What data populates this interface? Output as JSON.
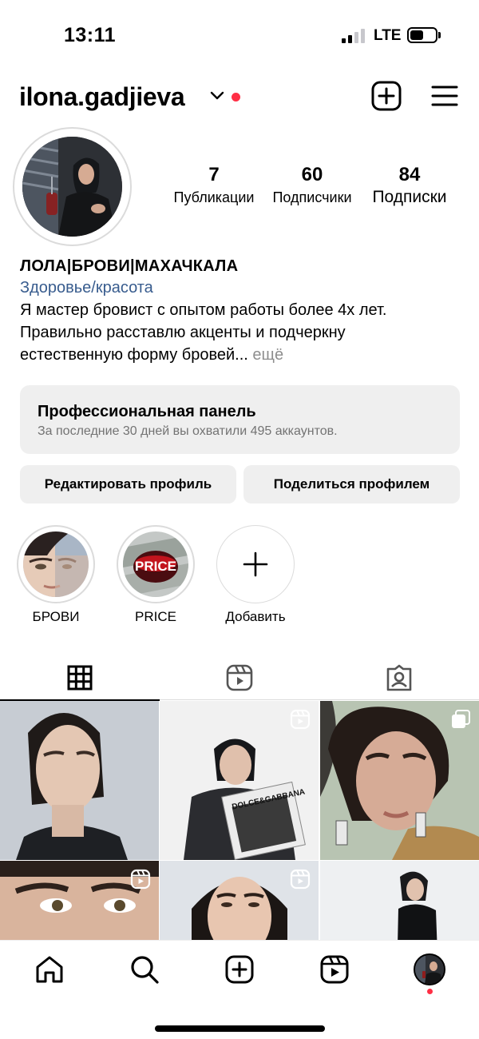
{
  "status_bar": {
    "time": "13:11",
    "network": "LTE"
  },
  "header": {
    "username": "ilona.gadjieva",
    "icons": {
      "dropdown": "chevron-down-icon",
      "notification": "red-dot",
      "create": "plus-square-icon",
      "menu": "hamburger-icon"
    }
  },
  "stats": [
    {
      "value": "7",
      "label": "Публикации"
    },
    {
      "value": "60",
      "label": "Подписчики"
    },
    {
      "value": "84",
      "label": "Подписки"
    }
  ],
  "bio": {
    "name": "ЛОЛА|БРОВИ|МАХАЧКАЛА",
    "category": "Здоровье/красота",
    "line1": "Я мастер бровист с опытом работы более 4х лет.",
    "line2": "Правильно расставлю акценты и подчеркну",
    "line3": "естественную форму бровей...",
    "more": "ещё"
  },
  "pro_panel": {
    "title": "Профессиональная панель",
    "subtitle": "За последние 30 дней вы охватили 495 аккаунтов."
  },
  "buttons": {
    "edit": "Редактировать профиль",
    "share": "Поделиться профилем"
  },
  "highlights": [
    {
      "label": "БРОВИ"
    },
    {
      "label": "PRICE",
      "cover_text": "PRICE"
    },
    {
      "label": "Добавить"
    }
  ],
  "tabs": [
    {
      "name": "grid",
      "icon": "grid-icon",
      "active": true
    },
    {
      "name": "reels",
      "icon": "reels-icon",
      "active": false
    },
    {
      "name": "tagged",
      "icon": "tagged-icon",
      "active": false
    }
  ],
  "posts": [
    {
      "type": "photo"
    },
    {
      "type": "reel",
      "overlay_text": "DOLCE&GABBANA"
    },
    {
      "type": "carousel"
    },
    {
      "type": "reel"
    },
    {
      "type": "reel"
    },
    {
      "type": "photo"
    }
  ],
  "bottom_nav": [
    "home-icon",
    "search-icon",
    "create-icon",
    "reels-icon",
    "profile-avatar"
  ],
  "colors": {
    "notification_dot": "#ff2f45",
    "category_link": "#385c8e",
    "panel_bg": "#efefef",
    "muted": "#737373"
  }
}
